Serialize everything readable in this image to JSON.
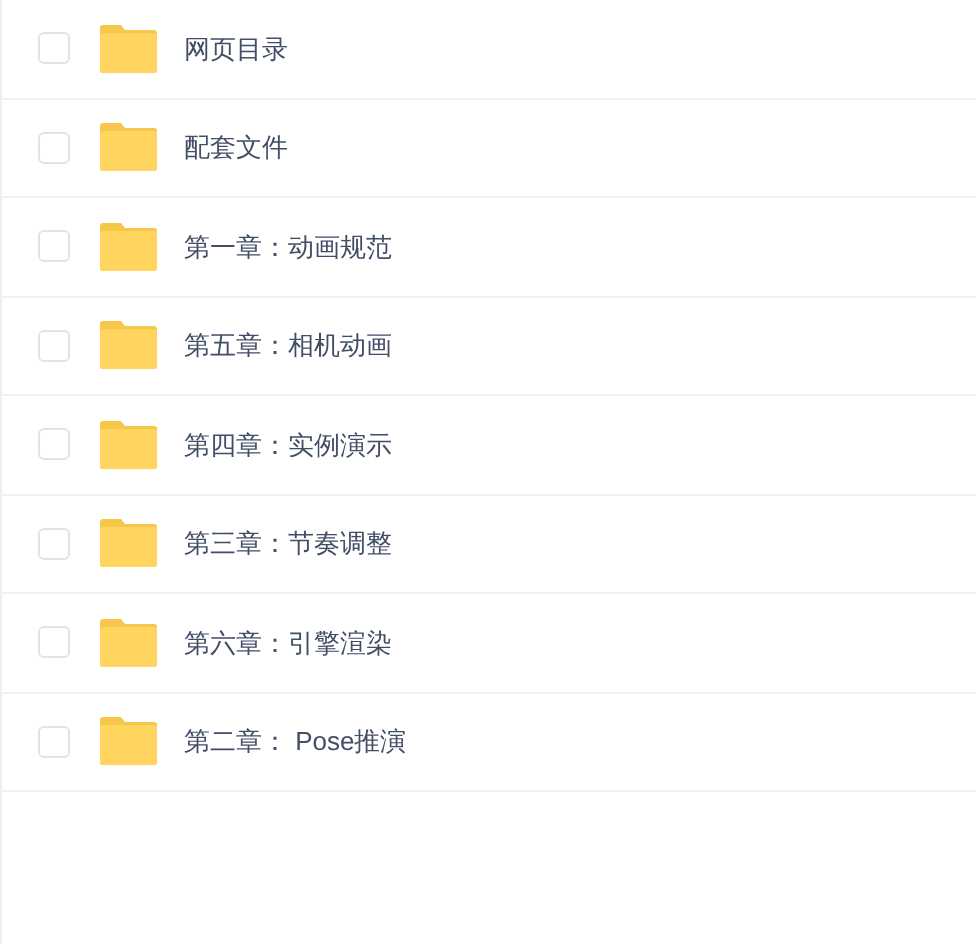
{
  "files": [
    {
      "name": "网页目录",
      "checked": false
    },
    {
      "name": "配套文件",
      "checked": false
    },
    {
      "name": "第一章：动画规范",
      "checked": false
    },
    {
      "name": "第五章：相机动画",
      "checked": false
    },
    {
      "name": "第四章：实例演示",
      "checked": false
    },
    {
      "name": "第三章：节奏调整",
      "checked": false
    },
    {
      "name": "第六章：引擎渲染",
      "checked": false
    },
    {
      "name": "第二章： Pose推演",
      "checked": false
    }
  ]
}
